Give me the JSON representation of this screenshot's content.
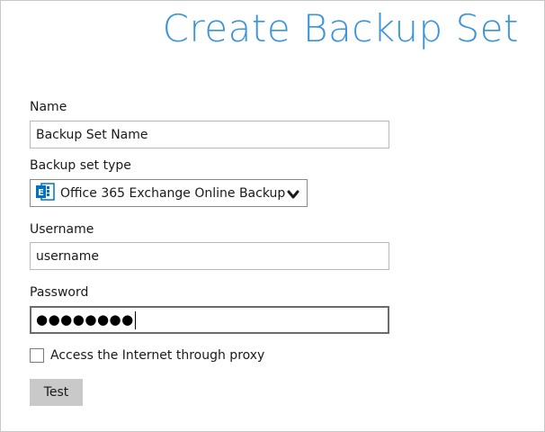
{
  "title": "Create Backup Set",
  "name": {
    "label": "Name",
    "value": "Backup Set Name"
  },
  "backup_type": {
    "label": "Backup set type",
    "selected": "Office 365 Exchange Online Backup",
    "icon": "exchange-icon",
    "icon_color": "#0072c6"
  },
  "username": {
    "label": "Username",
    "value": "username"
  },
  "password": {
    "label": "Password",
    "masked": "●●●●●●●●"
  },
  "proxy": {
    "label": "Access the Internet through proxy",
    "checked": false
  },
  "test_button": {
    "label": "Test"
  },
  "colors": {
    "title": "#3b93d8",
    "button_bg": "#c9c9c9"
  }
}
